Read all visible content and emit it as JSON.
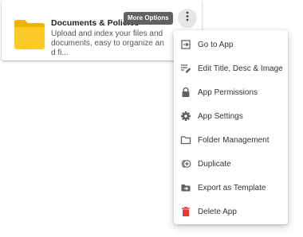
{
  "card": {
    "title": "Documents & Policies",
    "description": "Upload and index your files and documents, easy to organize and fi...",
    "icon": "folder-icon",
    "folder_color": "#ffc928"
  },
  "tooltip": {
    "text": "More Options"
  },
  "menu": {
    "items": [
      {
        "label": "Go to App",
        "icon": "go-to-app-icon"
      },
      {
        "label": "Edit Title, Desc & Image",
        "icon": "edit-icon"
      },
      {
        "label": "App Permissions",
        "icon": "lock-icon"
      },
      {
        "label": "App Settings",
        "icon": "gear-icon"
      },
      {
        "label": "Folder Management",
        "icon": "folder-outline-icon"
      },
      {
        "label": "Duplicate",
        "icon": "duplicate-icon"
      },
      {
        "label": "Export as Template",
        "icon": "export-folder-icon"
      },
      {
        "label": "Delete App",
        "icon": "trash-icon",
        "color": "#e53935"
      }
    ]
  }
}
